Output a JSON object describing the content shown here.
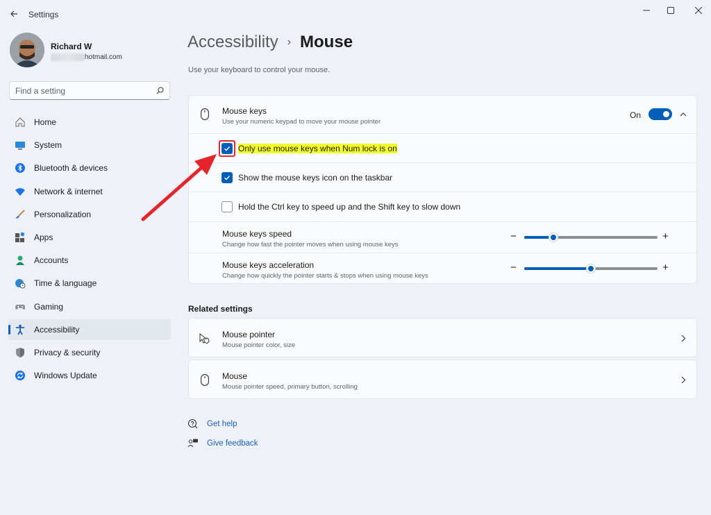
{
  "window": {
    "title": "Settings",
    "controls": [
      "minimize-icon",
      "maximize-icon",
      "close-icon"
    ]
  },
  "user": {
    "name": "Richard W",
    "email_visible": "hotmail.com"
  },
  "search": {
    "placeholder": "Find a setting",
    "value": ""
  },
  "sidebar": {
    "items": [
      {
        "label": "Home",
        "icon": "home-icon",
        "active": false
      },
      {
        "label": "System",
        "icon": "system-icon",
        "active": false
      },
      {
        "label": "Bluetooth & devices",
        "icon": "bluetooth-icon",
        "active": false
      },
      {
        "label": "Network & internet",
        "icon": "wifi-icon",
        "active": false
      },
      {
        "label": "Personalization",
        "icon": "brush-icon",
        "active": false
      },
      {
        "label": "Apps",
        "icon": "apps-icon",
        "active": false
      },
      {
        "label": "Accounts",
        "icon": "accounts-icon",
        "active": false
      },
      {
        "label": "Time & language",
        "icon": "globe-clock-icon",
        "active": false
      },
      {
        "label": "Gaming",
        "icon": "gamepad-icon",
        "active": false
      },
      {
        "label": "Accessibility",
        "icon": "accessibility-icon",
        "active": true
      },
      {
        "label": "Privacy & security",
        "icon": "shield-icon",
        "active": false
      },
      {
        "label": "Windows Update",
        "icon": "update-icon",
        "active": false
      }
    ]
  },
  "header": {
    "parent": "Accessibility",
    "separator": "›",
    "current": "Mouse",
    "description": "Use your keyboard to control your mouse."
  },
  "mouse_keys": {
    "title": "Mouse keys",
    "subtitle": "Use your numeric keypad to move your mouse pointer",
    "state_label": "On",
    "enabled": true,
    "expanded": true,
    "options": [
      {
        "label": "Only use mouse keys when Num lock is on",
        "checked": true,
        "highlighted": true
      },
      {
        "label": "Show the mouse keys icon on the taskbar",
        "checked": true,
        "highlighted": false
      },
      {
        "label": "Hold the Ctrl key to speed up and the Shift key to slow down",
        "checked": false,
        "highlighted": false
      }
    ],
    "speed": {
      "title": "Mouse keys speed",
      "subtitle": "Change how fast the pointer moves when using mouse keys",
      "value_fraction": 0.22
    },
    "acceleration": {
      "title": "Mouse keys acceleration",
      "subtitle": "Change how quickly the pointer starts & stops when using mouse keys",
      "value_fraction": 0.5
    },
    "minus_symbol": "−",
    "plus_symbol": "+"
  },
  "related": {
    "title": "Related settings",
    "items": [
      {
        "title": "Mouse pointer",
        "subtitle": "Mouse pointer color, size",
        "icon": "mouse-pointer-icon"
      },
      {
        "title": "Mouse",
        "subtitle": "Mouse pointer speed, primary button, scrolling",
        "icon": "mouse-icon"
      }
    ]
  },
  "help": {
    "get_help": "Get help",
    "give_feedback": "Give feedback"
  },
  "colors": {
    "accent": "#005fb8",
    "annotation_red": "#e4262c",
    "highlight_yellow": "#f4ff2a"
  }
}
